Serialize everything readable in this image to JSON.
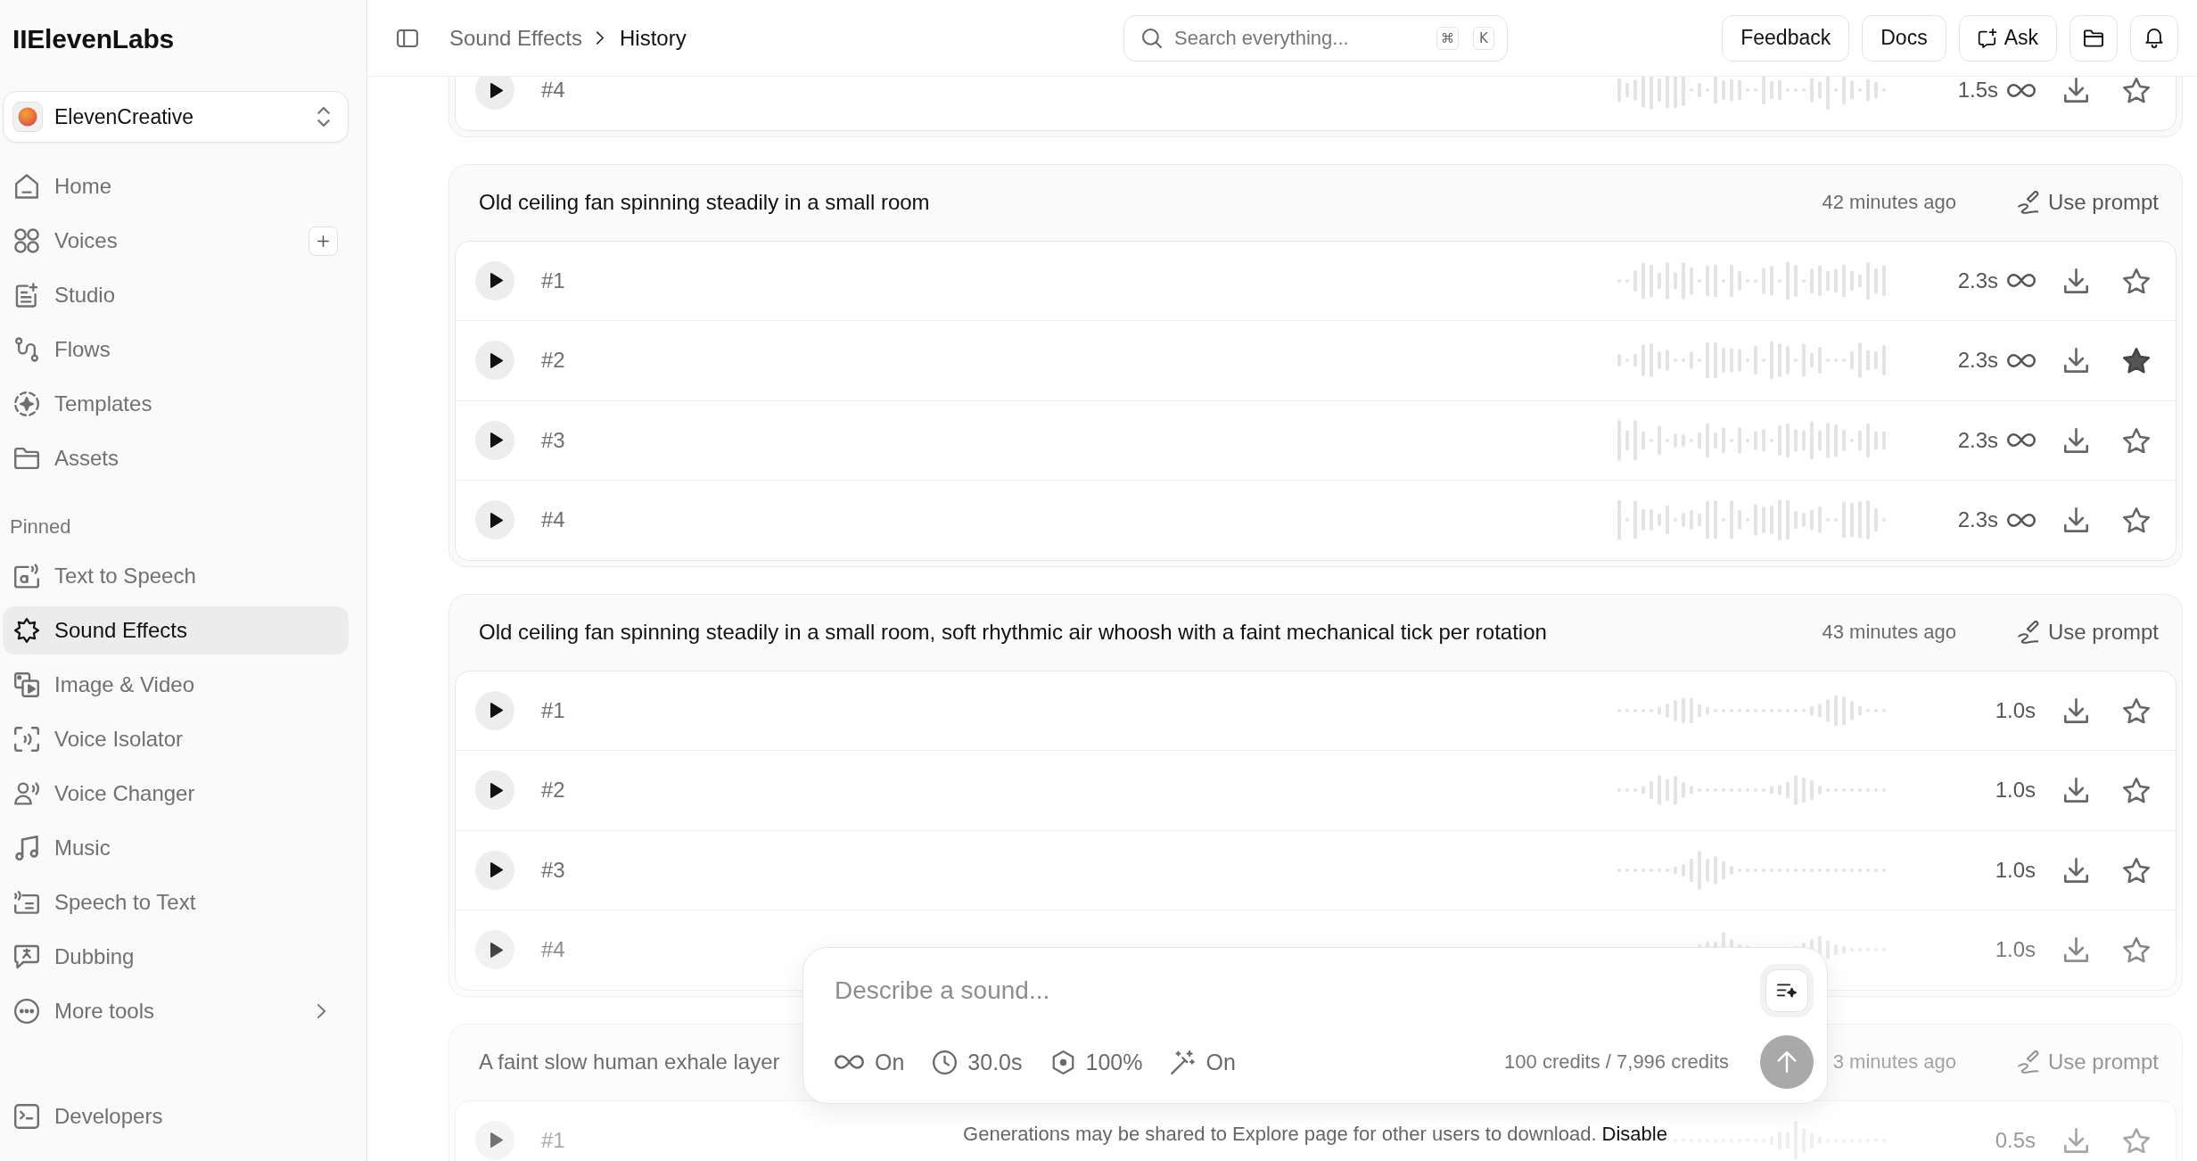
{
  "sidebar": {
    "logo": "IIElevenLabs",
    "workspace": "ElevenCreative",
    "nav": [
      {
        "label": "Home",
        "kind": "link",
        "selected": false
      },
      {
        "label": "Voices",
        "kind": "add",
        "selected": false
      },
      {
        "label": "Studio",
        "kind": "link",
        "selected": false
      },
      {
        "label": "Flows",
        "kind": "link",
        "selected": false
      },
      {
        "label": "Templates",
        "kind": "link",
        "selected": false
      },
      {
        "label": "Assets",
        "kind": "link",
        "selected": false
      }
    ],
    "section_label": "Pinned",
    "pinned": [
      {
        "label": "Text to Speech",
        "kind": "link",
        "selected": false
      },
      {
        "label": "Sound Effects",
        "kind": "link",
        "selected": true
      },
      {
        "label": "Image & Video",
        "kind": "link",
        "selected": false
      },
      {
        "label": "Voice Isolator",
        "kind": "link",
        "selected": false
      },
      {
        "label": "Voice Changer",
        "kind": "link",
        "selected": false
      },
      {
        "label": "Music",
        "kind": "link",
        "selected": false
      },
      {
        "label": "Speech to Text",
        "kind": "link",
        "selected": false
      },
      {
        "label": "Dubbing",
        "kind": "link",
        "selected": false
      },
      {
        "label": "More tools",
        "kind": "submenu",
        "selected": false
      }
    ],
    "footer": [
      {
        "label": "Developers",
        "kind": "link",
        "selected": false
      }
    ]
  },
  "topbar": {
    "breadcrumb": [
      {
        "label": "Sound Effects",
        "current": false
      },
      {
        "label": "History",
        "current": true
      }
    ],
    "search": {
      "placeholder": "Search everything...",
      "shortcut": [
        "⌘",
        "K"
      ]
    },
    "buttons": [
      {
        "label": "Feedback",
        "kind": "plain"
      },
      {
        "label": "Docs",
        "kind": "plain"
      },
      {
        "label": "Ask",
        "kind": "with-icon"
      }
    ]
  },
  "groups": [
    {
      "rows": [
        {
          "label": "#4",
          "duration": "1.5s",
          "loop": true,
          "starred": false
        }
      ]
    },
    {
      "prompt": "Old ceiling fan spinning steadily in a small room",
      "time": "42 minutes ago",
      "action": "Use prompt",
      "rows": [
        {
          "label": "#1",
          "duration": "2.3s",
          "loop": true,
          "starred": false
        },
        {
          "label": "#2",
          "duration": "2.3s",
          "loop": true,
          "starred": true
        },
        {
          "label": "#3",
          "duration": "2.3s",
          "loop": true,
          "starred": false
        },
        {
          "label": "#4",
          "duration": "2.3s",
          "loop": true,
          "starred": false
        }
      ]
    },
    {
      "prompt": "Old ceiling fan spinning steadily in a small room, soft rhythmic air whoosh with a faint mechanical tick per rotation",
      "time": "43 minutes ago",
      "action": "Use prompt",
      "rows": [
        {
          "label": "#1",
          "duration": "1.0s",
          "loop": false,
          "starred": false
        },
        {
          "label": "#2",
          "duration": "1.0s",
          "loop": false,
          "starred": false
        },
        {
          "label": "#3",
          "duration": "1.0s",
          "loop": false,
          "starred": false
        },
        {
          "label": "#4",
          "duration": "1.0s",
          "loop": false,
          "starred": false
        }
      ]
    },
    {
      "prompt": "A faint slow human exhale layer",
      "time": "3 minutes ago",
      "action": "Use prompt",
      "rows": [
        {
          "label": "#1",
          "duration": "0.5s",
          "loop": false,
          "starred": false
        }
      ]
    }
  ],
  "composer": {
    "placeholder": "Describe a sound...",
    "options": [
      {
        "value": "On"
      },
      {
        "value": "30.0s"
      },
      {
        "value": "100%"
      },
      {
        "value": "On"
      }
    ],
    "credits": "100 credits / 7,996 credits"
  },
  "notice": {
    "text": "Generations may be shared to Explore page for other users to download.",
    "link": "Disable"
  }
}
